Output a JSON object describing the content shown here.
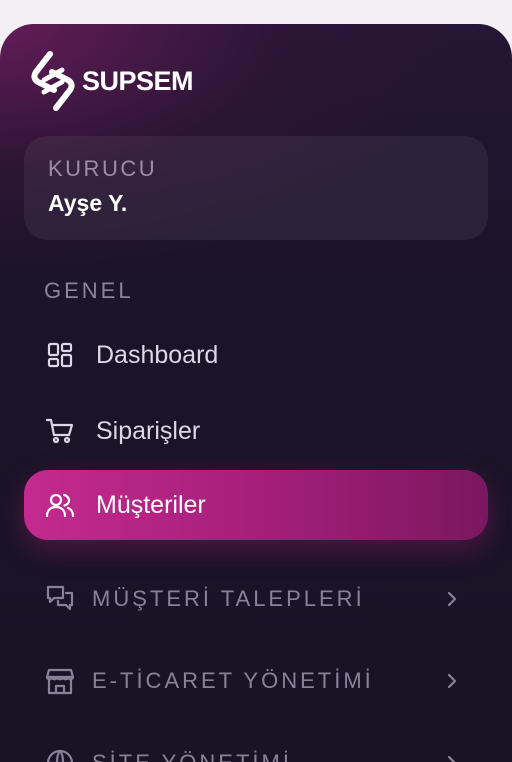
{
  "brand": {
    "name": "SUPSEM",
    "logo_icon": "supsem-s-logo-icon"
  },
  "user": {
    "role": "KURUCU",
    "name": "Ayşe Y."
  },
  "sections": {
    "general_label": "GENEL"
  },
  "nav": {
    "dashboard": {
      "label": "Dashboard",
      "icon": "dashboard-grid-icon"
    },
    "orders": {
      "label": "Siparişler",
      "icon": "cart-icon"
    },
    "customers": {
      "label": "Müşteriler",
      "icon": "users-icon",
      "active": true
    }
  },
  "groups": {
    "requests": {
      "label": "MÜŞTERİ TALEPLERİ",
      "icon": "chat-bubbles-icon"
    },
    "ecommerce": {
      "label": "E-TİCARET YÖNETİMİ",
      "icon": "store-icon"
    },
    "site": {
      "label": "SİTE YÖNETİMİ",
      "icon": "globe-icon"
    }
  },
  "colors": {
    "accent": "#c42a8e",
    "sidebar_bg": "#1b1428",
    "muted_text": "#8a8196"
  }
}
